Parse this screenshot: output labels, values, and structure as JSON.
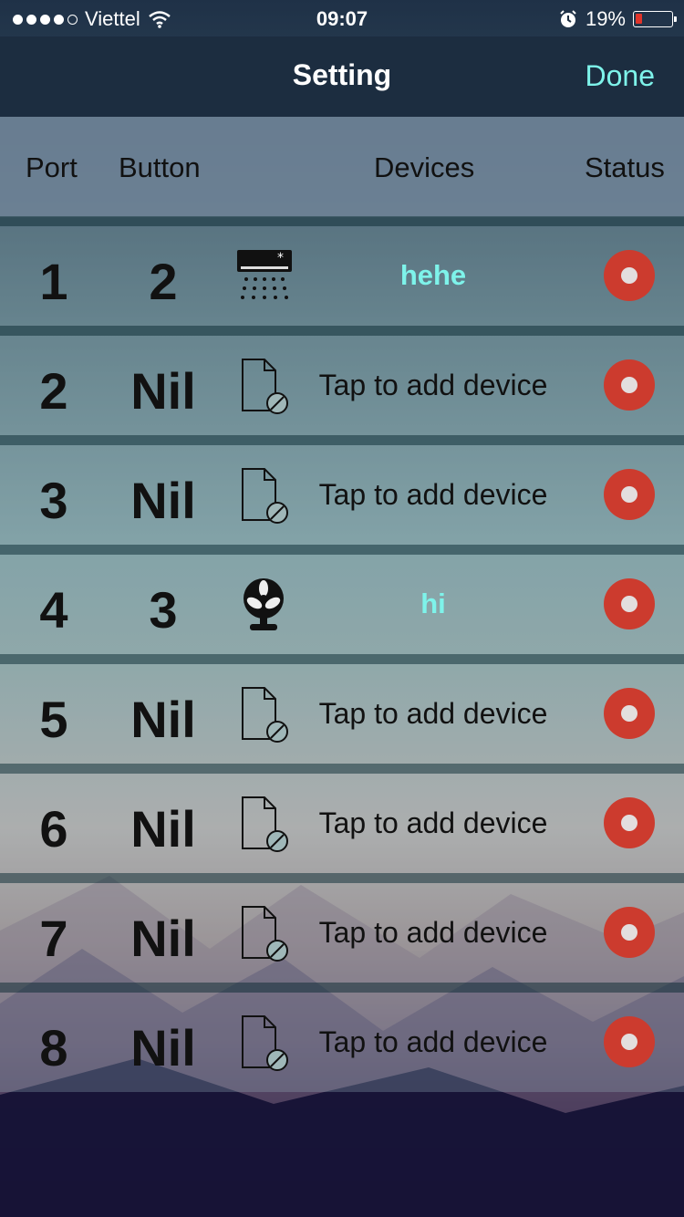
{
  "status_bar": {
    "carrier": "Viettel",
    "time": "09:07",
    "battery_text": "19%",
    "battery_level": 0.19
  },
  "nav": {
    "title": "Setting",
    "done_label": "Done"
  },
  "columns": {
    "port": "Port",
    "button": "Button",
    "devices": "Devices",
    "status": "Status"
  },
  "rows": [
    {
      "port": "1",
      "button": "2",
      "device": "hehe",
      "icon": "air-conditioner-icon",
      "named": true
    },
    {
      "port": "2",
      "button": "Nil",
      "device": "Tap to add device",
      "icon": "no-device-file-icon",
      "named": false
    },
    {
      "port": "3",
      "button": "Nil",
      "device": "Tap to add device",
      "icon": "no-device-file-icon",
      "named": false
    },
    {
      "port": "4",
      "button": "3",
      "device": "hi",
      "icon": "fan-icon",
      "named": true
    },
    {
      "port": "5",
      "button": "Nil",
      "device": "Tap to add device",
      "icon": "no-device-file-icon",
      "named": false
    },
    {
      "port": "6",
      "button": "Nil",
      "device": "Tap to add device",
      "icon": "no-device-file-icon",
      "named": false
    },
    {
      "port": "7",
      "button": "Nil",
      "device": "Tap to add device",
      "icon": "no-device-file-icon",
      "named": false
    },
    {
      "port": "8",
      "button": "Nil",
      "device": "Tap to add device",
      "icon": "no-device-file-icon",
      "named": false
    }
  ],
  "colors": {
    "accent": "#7ef3ea",
    "status_off": "#cc3b2e",
    "navbar": "#1c2d40"
  }
}
